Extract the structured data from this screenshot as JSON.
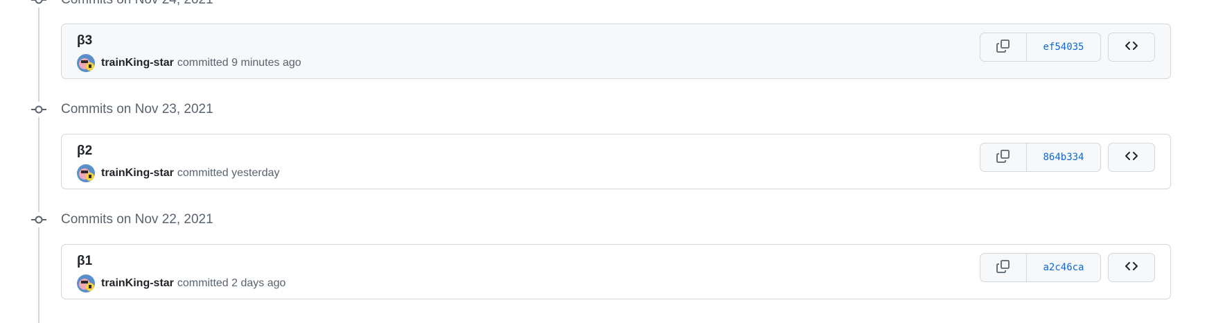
{
  "groups": [
    {
      "title": "Commits on Nov 24, 2021",
      "commit": {
        "message": "β3",
        "author": "trainKing-star",
        "action": "committed",
        "time": "9 minutes ago",
        "sha": "ef54035"
      }
    },
    {
      "title": "Commits on Nov 23, 2021",
      "commit": {
        "message": "β2",
        "author": "trainKing-star",
        "action": "committed",
        "time": "yesterday",
        "sha": "864b334"
      }
    },
    {
      "title": "Commits on Nov 22, 2021",
      "commit": {
        "message": "β1",
        "author": "trainKing-star",
        "action": "committed",
        "time": "2 days ago",
        "sha": "a2c46ca"
      }
    }
  ],
  "icons": {
    "node": "git-commit-icon",
    "copy": "copy-icon",
    "browse": "code-icon"
  },
  "colors": {
    "link": "#0969da",
    "muted_text": "#59636e",
    "border": "#d0d7de",
    "button_bg": "#f6f8fa"
  }
}
